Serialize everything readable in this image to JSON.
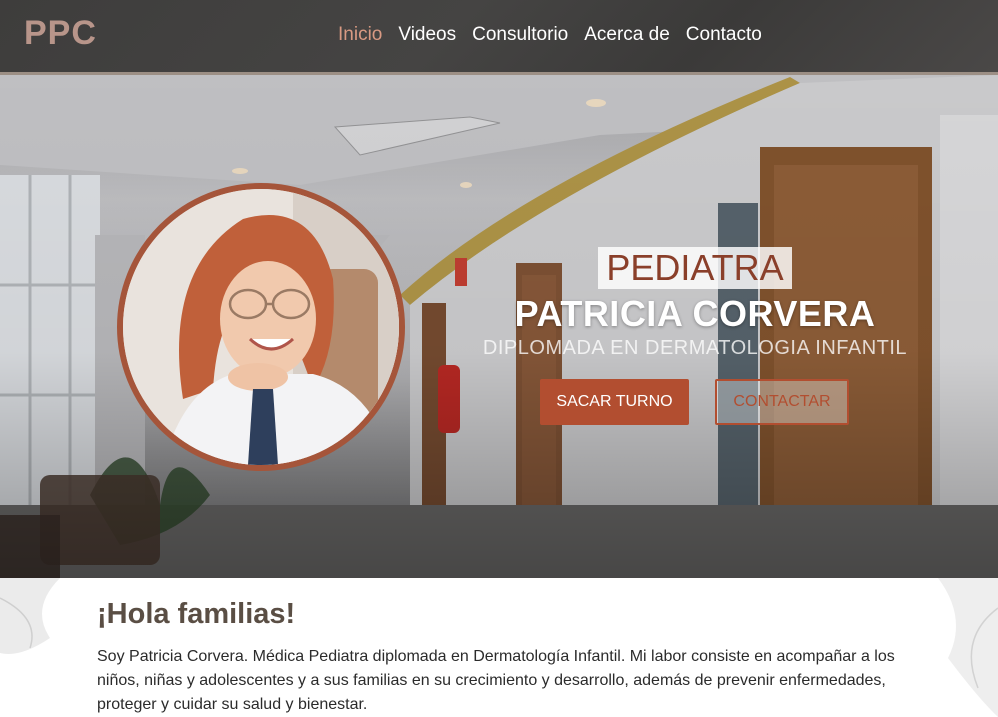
{
  "brand": {
    "logo_text": "PPC"
  },
  "nav": {
    "items": [
      {
        "label": "Inicio",
        "active": true
      },
      {
        "label": "Videos",
        "active": false
      },
      {
        "label": "Consultorio",
        "active": false
      },
      {
        "label": "Acerca de",
        "active": false
      },
      {
        "label": "Contacto",
        "active": false
      }
    ]
  },
  "hero": {
    "role": "PEDIATRA",
    "name": "PATRICIA CORVERA",
    "subtitle": "DIPLOMADA EN DERMATOLOGIA INFANTIL",
    "primary_button": "SACAR TURNO",
    "secondary_button": "CONTACTAR"
  },
  "intro": {
    "title": "¡Hola familias!",
    "body": "Soy Patricia Corvera. Médica Pediatra diplomada en Dermatología Infantil. Mi labor consiste en acompañar a los niños, niñas y adolescentes y a sus familias en su crecimiento y desarrollo, además de prevenir enfermedades, proteger y cuidar su salud y bienestar."
  },
  "colors": {
    "nav_bg": "#424140",
    "logo": "#b8958a",
    "accent": "#b24e30",
    "active_link": "#d99a83",
    "title_text": "#5a4e44"
  }
}
